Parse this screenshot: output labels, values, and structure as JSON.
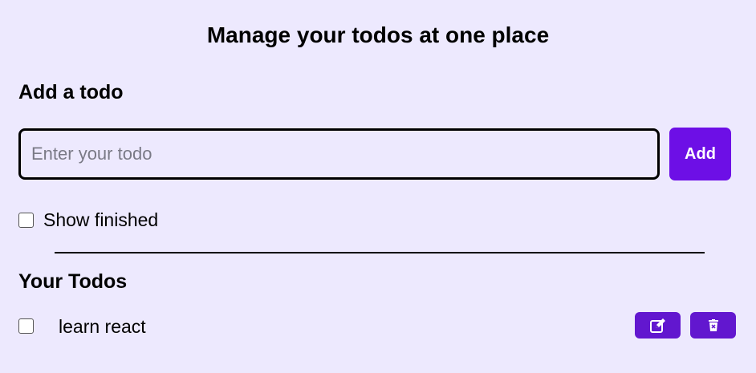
{
  "header": {
    "title": "Manage your todos at one place"
  },
  "add_section": {
    "heading": "Add a todo",
    "input_placeholder": "Enter your todo",
    "input_value": "",
    "add_label": "Add"
  },
  "filters": {
    "show_finished_label": "Show finished",
    "show_finished_checked": false
  },
  "todos_section": {
    "heading": "Your Todos",
    "items": [
      {
        "text": "learn react",
        "completed": false,
        "edit_icon": "edit-icon",
        "delete_icon": "trash-icon"
      }
    ]
  },
  "colors": {
    "background": "#ede9fe",
    "accent": "#6d0fe6",
    "action_button": "#6217cf"
  }
}
